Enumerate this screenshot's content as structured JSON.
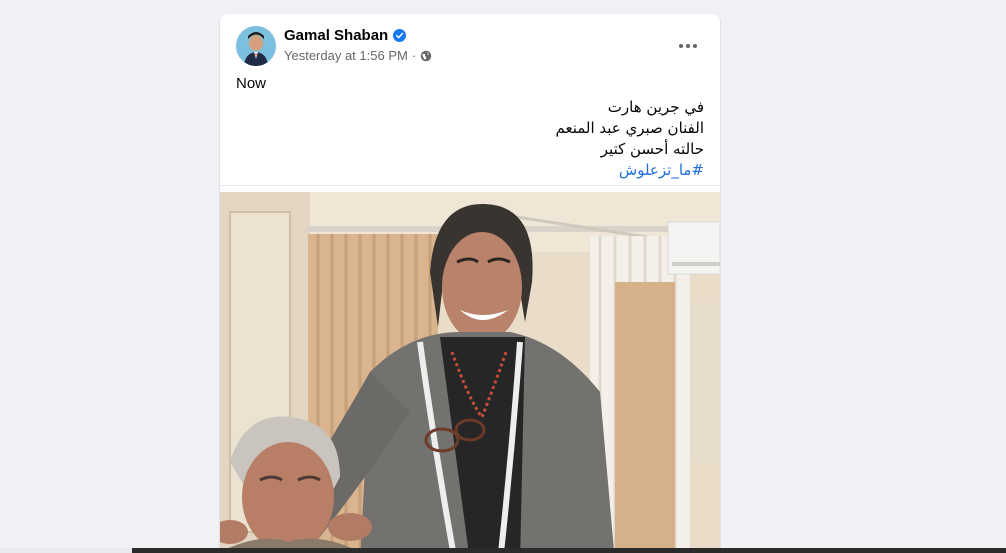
{
  "post": {
    "author": {
      "name": "Gamal Shaban",
      "verified": true,
      "avatar_icon": "profile-avatar"
    },
    "meta": {
      "timestamp": "Yesterday at 1:56 PM",
      "separator": "·",
      "audience_icon": "globe-icon"
    },
    "more_icon": "more-horizontal-icon",
    "text": {
      "line1": "Now",
      "arabic_lines": [
        "في جرين هارت",
        "الفنان صبري عبد المنعم",
        "حالته أحسن كتير"
      ],
      "hashtag": "#ما_تزعلوش"
    },
    "photo": {
      "alt_icon": "post-photo"
    }
  },
  "colors": {
    "page_bg": "#f0f2f5",
    "card_bg": "#ffffff",
    "hashtag": "#216fdb",
    "meta_text": "#65676b",
    "verified": "#1877f2"
  }
}
